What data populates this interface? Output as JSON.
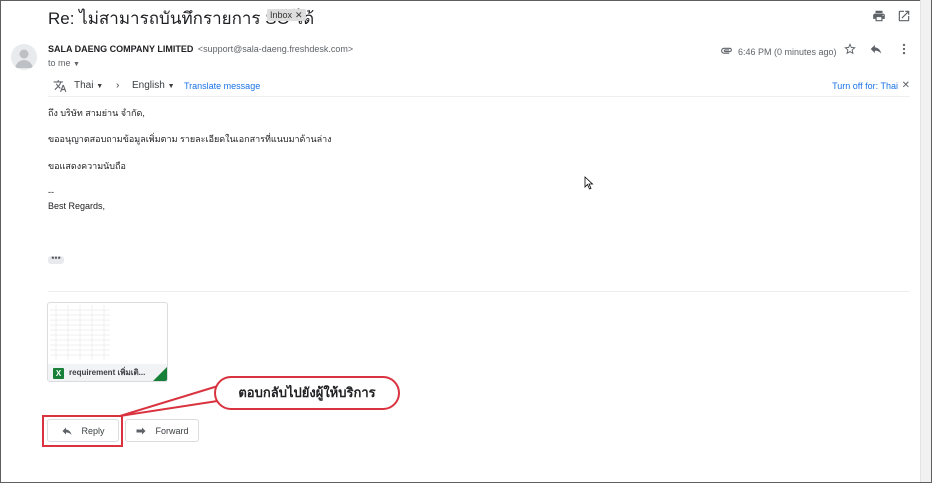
{
  "email": {
    "subject": "Re: ไม่สามารถบันทึกรายการ SO ได้",
    "label_chip": "Inbox",
    "sender_name": "SALA DAENG COMPANY LIMITED",
    "sender_email": "<support@sala-daeng.freshdesk.com>",
    "recipient": "to me",
    "time": "6:46 PM (0 minutes ago)"
  },
  "translate_bar": {
    "source_lang": "Thai",
    "target_lang": "English",
    "translate_link": "Translate message",
    "turn_off": "Turn off for: Thai"
  },
  "body": {
    "greeting": "ถึง บริษัท สามย่าน จำกัด,",
    "line1": "ขออนุญาตสอบถามข้อมูลเพิ่มตาม รายละเอียดในเอกสารที่แนบมาด้านล่าง",
    "closing": "ขอแสดงความนับถือ",
    "sig_dash": "--",
    "sig_text": "Best Regards,",
    "ellipsis": "•••"
  },
  "attachment": {
    "filename": "requirement เพิ่มเติ...",
    "type_badge": "X"
  },
  "actions": {
    "reply_label": "Reply",
    "forward_label": "Forward"
  },
  "annotation": {
    "callout_text": "ตอบกลับไปยังผู้ให้บริการ"
  },
  "colors": {
    "highlight": "#d9333f",
    "link": "#1a73e8",
    "excel_green": "#188038"
  }
}
